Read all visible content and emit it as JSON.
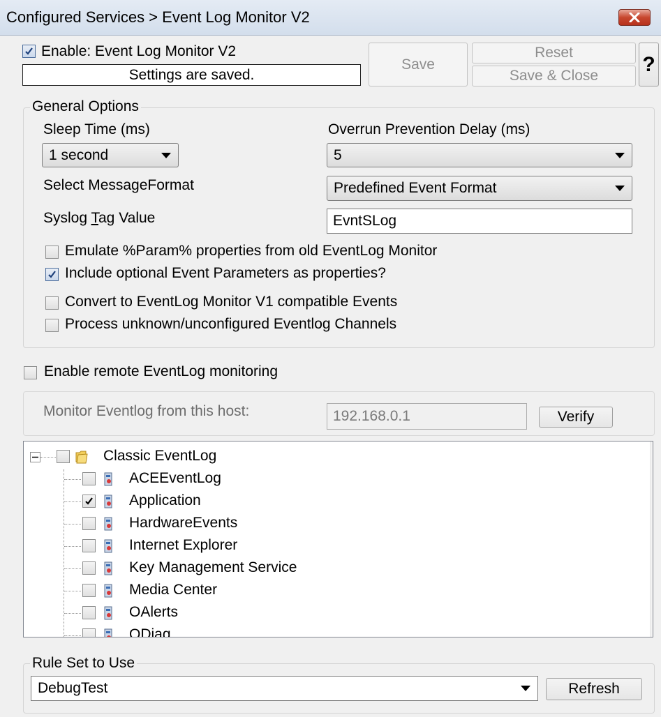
{
  "window": {
    "title": "Configured Services > Event Log Monitor V2"
  },
  "header": {
    "enable_label": "Enable: Event Log Monitor V2",
    "enable_checked": true,
    "status_text": "Settings are saved.",
    "save_label": "Save",
    "reset_label": "Reset",
    "save_close_label": "Save & Close",
    "help_label": "?"
  },
  "general_options": {
    "title": "General Options",
    "sleep_time_label": "Sleep Time (ms)",
    "sleep_time_value": "1 second",
    "overrun_label": "Overrun Prevention Delay (ms)",
    "overrun_value": "5",
    "message_format_label": "Select MessageFormat",
    "message_format_value": "Predefined Event Format",
    "syslog_tag_label_pre": "Syslog ",
    "syslog_tag_label_u": "T",
    "syslog_tag_label_post": "ag Value",
    "syslog_tag_value": "EvntSLog",
    "options": [
      {
        "label": "Emulate %Param% properties from old EventLog Monitor",
        "checked": false
      },
      {
        "label": "Include optional Event Parameters as properties?",
        "checked": true
      },
      {
        "label": "Convert to EventLog Monitor V1 compatible Events",
        "checked": false
      },
      {
        "label": "Process unknown/unconfigured Eventlog Channels",
        "checked": false
      }
    ]
  },
  "remote": {
    "enable_label": "Enable remote EventLog monitoring",
    "enable_checked": false,
    "host_label": "Monitor Eventlog from this host:",
    "host_value": "192.168.0.1",
    "verify_label": "Verify"
  },
  "tree": {
    "root_label": "Classic EventLog",
    "root_checked": false,
    "children": [
      {
        "label": "ACEEventLog",
        "checked": false
      },
      {
        "label": "Application",
        "checked": true
      },
      {
        "label": "HardwareEvents",
        "checked": false
      },
      {
        "label": "Internet Explorer",
        "checked": false
      },
      {
        "label": "Key Management Service",
        "checked": false
      },
      {
        "label": "Media Center",
        "checked": false
      },
      {
        "label": "OAlerts",
        "checked": false
      },
      {
        "label": "ODiag",
        "checked": false
      }
    ]
  },
  "ruleset": {
    "title": "Rule Set to Use",
    "value": "DebugTest",
    "refresh_label": "Refresh"
  },
  "colors": {
    "close_button": "#c7472f",
    "titlebar": "#d3deec",
    "window_bg": "#f0f0f0"
  }
}
